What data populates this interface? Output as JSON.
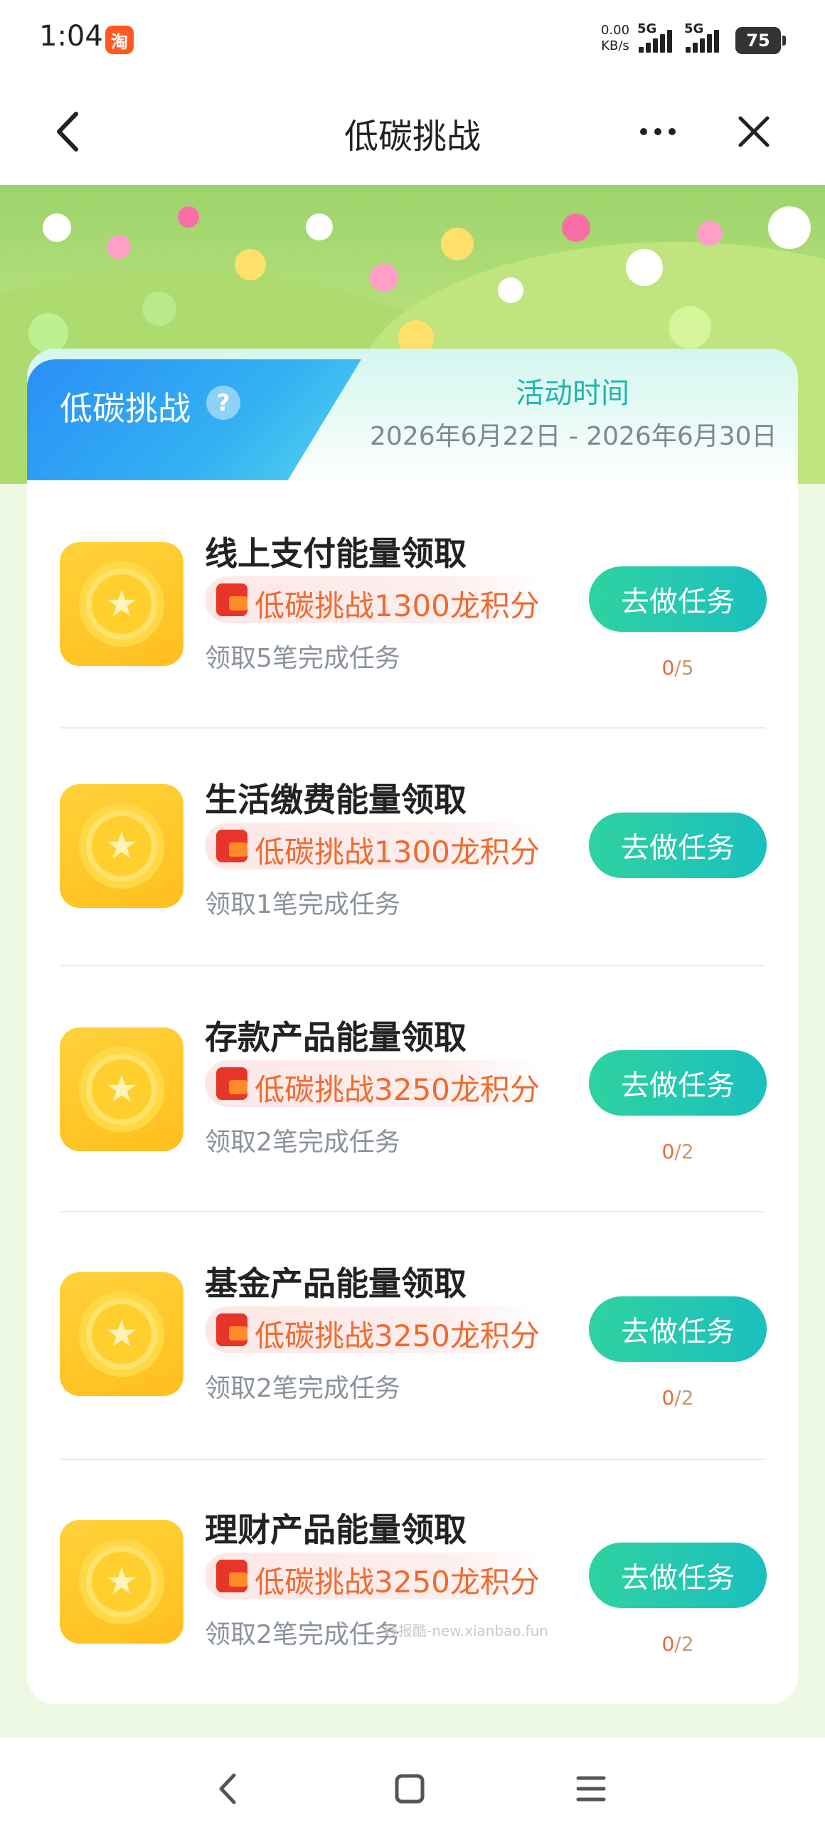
{
  "status_bar": {
    "time": "1:04",
    "app_badge": "淘",
    "net_speed_value": "0.00",
    "net_speed_unit": "KB/s",
    "signal_1": "5G",
    "signal_2": "5G",
    "battery": "75"
  },
  "nav": {
    "title": "低碳挑战"
  },
  "header": {
    "tab_title": "低碳挑战",
    "help": "?",
    "activity_label": "活动时间",
    "activity_range": "2026年6月22日 - 2026年6月30日"
  },
  "tasks": [
    {
      "title": "线上支付能量领取",
      "reward": "低碳挑战1300龙积分",
      "subtitle": "领取5笔完成任务",
      "button": "去做任务",
      "progress_done": "0",
      "progress_total": "/5"
    },
    {
      "title": "生活缴费能量领取",
      "reward": "低碳挑战1300龙积分",
      "subtitle": "领取1笔完成任务",
      "button": "去做任务",
      "progress_done": "",
      "progress_total": ""
    },
    {
      "title": "存款产品能量领取",
      "reward": "低碳挑战3250龙积分",
      "subtitle": "领取2笔完成任务",
      "button": "去做任务",
      "progress_done": "0",
      "progress_total": "/2"
    },
    {
      "title": "基金产品能量领取",
      "reward": "低碳挑战3250龙积分",
      "subtitle": "领取2笔完成任务",
      "button": "去做任务",
      "progress_done": "0",
      "progress_total": "/2"
    },
    {
      "title": "理财产品能量领取",
      "reward": "低碳挑战3250龙积分",
      "subtitle": "领取2笔完成任务",
      "button": "去做任务",
      "progress_done": "0",
      "progress_total": "/2"
    }
  ],
  "watermark": "线报酷-new.xianbao.fun",
  "colors": {
    "accent_green": "#1bbfbf",
    "reward_orange": "#f06a2e",
    "tab_blue": "#2a8ff7"
  }
}
